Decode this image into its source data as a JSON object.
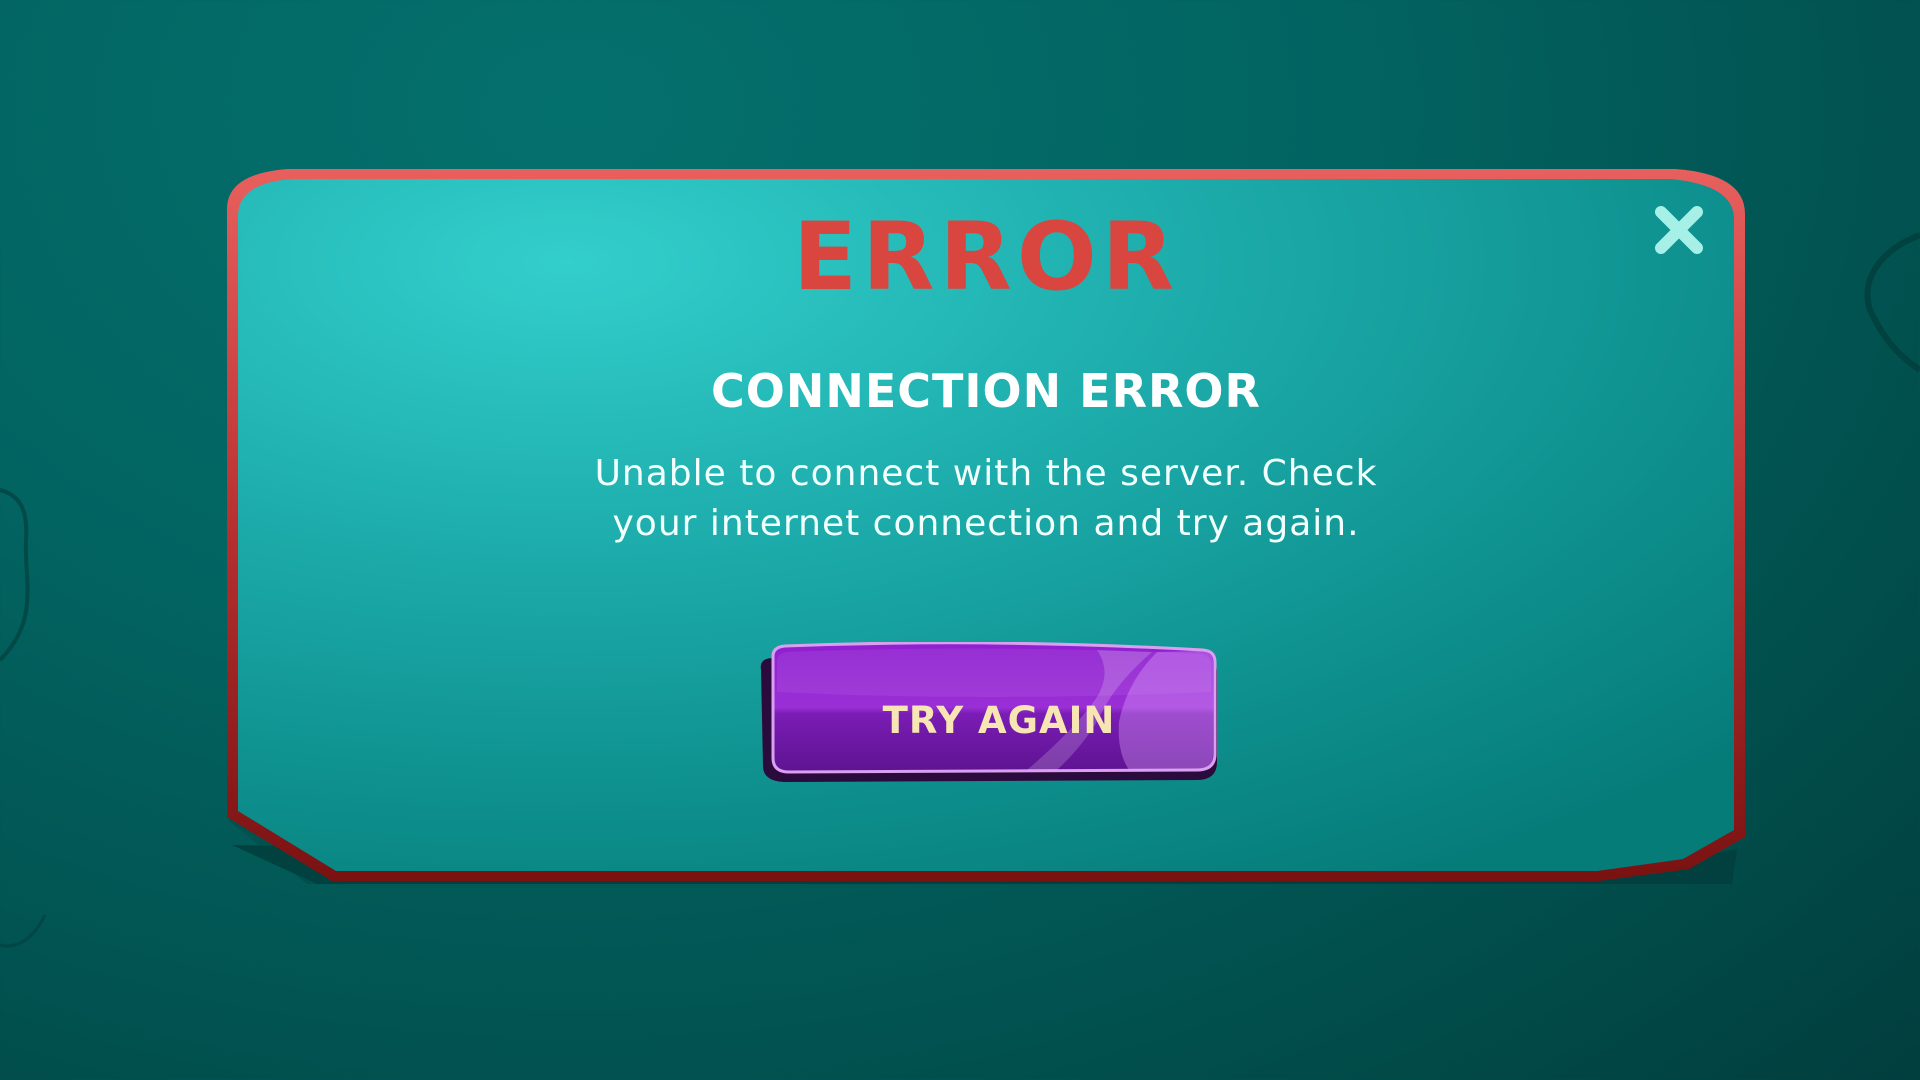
{
  "dialog": {
    "title": "ERROR",
    "subtitle": "CONNECTION ERROR",
    "message": "Unable to connect with the server. Check your internet connection and try again.",
    "primary_button_label": "TRY AGAIN",
    "close_icon": "close-icon"
  },
  "colors": {
    "background": "#026461",
    "panel_fill": "#1fb3b3",
    "panel_border_top": "#e65a5a",
    "panel_border_bottom": "#7a1414",
    "title": "#d9453f",
    "button": "#8a1fc2",
    "button_label": "#f7e6b4",
    "close_icon": "#a6f0e8"
  }
}
